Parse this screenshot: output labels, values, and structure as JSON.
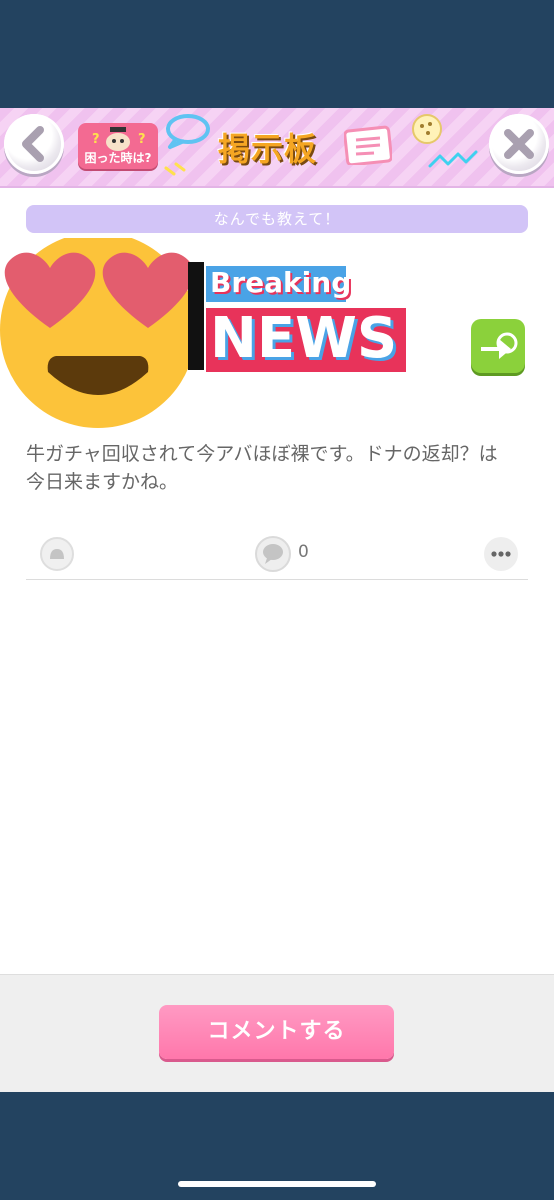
{
  "header": {
    "title": "掲示板",
    "help_label": "困った時は?",
    "back_icon": "chevron-left-icon",
    "close_icon": "close-icon"
  },
  "post": {
    "category": "なんでも教えて！",
    "image_text_top": "Breaking",
    "image_text_main": "NEWS",
    "body": "牛ガチャ回収されて今アバほぼ裸です。ドナの返却？は今日来ますかね。",
    "comment_count": "0"
  },
  "footer": {
    "comment_button": "コメントする"
  },
  "colors": {
    "header_bg": "#f0c2ef",
    "category_pill": "#d2c4f7",
    "comment_button": "#ff88b8",
    "share_button": "#8bd13b",
    "news_red": "#e8335a",
    "news_blue": "#4aa3e6",
    "frame_bg": "#234360"
  }
}
